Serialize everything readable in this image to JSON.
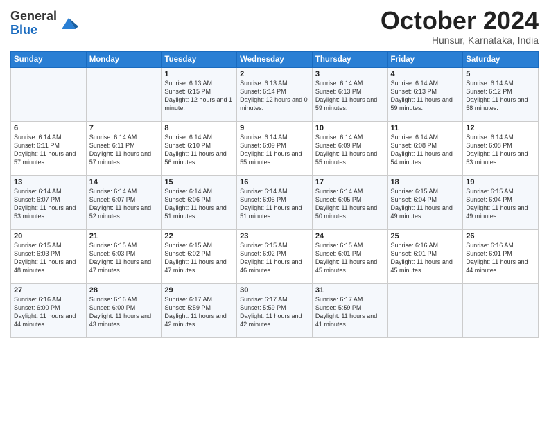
{
  "logo": {
    "general": "General",
    "blue": "Blue"
  },
  "header": {
    "month": "October 2024",
    "location": "Hunsur, Karnataka, India"
  },
  "days_of_week": [
    "Sunday",
    "Monday",
    "Tuesday",
    "Wednesday",
    "Thursday",
    "Friday",
    "Saturday"
  ],
  "weeks": [
    [
      {
        "day": "",
        "info": ""
      },
      {
        "day": "",
        "info": ""
      },
      {
        "day": "1",
        "info": "Sunrise: 6:13 AM\nSunset: 6:15 PM\nDaylight: 12 hours and 1 minute."
      },
      {
        "day": "2",
        "info": "Sunrise: 6:13 AM\nSunset: 6:14 PM\nDaylight: 12 hours and 0 minutes."
      },
      {
        "day": "3",
        "info": "Sunrise: 6:14 AM\nSunset: 6:13 PM\nDaylight: 11 hours and 59 minutes."
      },
      {
        "day": "4",
        "info": "Sunrise: 6:14 AM\nSunset: 6:13 PM\nDaylight: 11 hours and 59 minutes."
      },
      {
        "day": "5",
        "info": "Sunrise: 6:14 AM\nSunset: 6:12 PM\nDaylight: 11 hours and 58 minutes."
      }
    ],
    [
      {
        "day": "6",
        "info": "Sunrise: 6:14 AM\nSunset: 6:11 PM\nDaylight: 11 hours and 57 minutes."
      },
      {
        "day": "7",
        "info": "Sunrise: 6:14 AM\nSunset: 6:11 PM\nDaylight: 11 hours and 57 minutes."
      },
      {
        "day": "8",
        "info": "Sunrise: 6:14 AM\nSunset: 6:10 PM\nDaylight: 11 hours and 56 minutes."
      },
      {
        "day": "9",
        "info": "Sunrise: 6:14 AM\nSunset: 6:09 PM\nDaylight: 11 hours and 55 minutes."
      },
      {
        "day": "10",
        "info": "Sunrise: 6:14 AM\nSunset: 6:09 PM\nDaylight: 11 hours and 55 minutes."
      },
      {
        "day": "11",
        "info": "Sunrise: 6:14 AM\nSunset: 6:08 PM\nDaylight: 11 hours and 54 minutes."
      },
      {
        "day": "12",
        "info": "Sunrise: 6:14 AM\nSunset: 6:08 PM\nDaylight: 11 hours and 53 minutes."
      }
    ],
    [
      {
        "day": "13",
        "info": "Sunrise: 6:14 AM\nSunset: 6:07 PM\nDaylight: 11 hours and 53 minutes."
      },
      {
        "day": "14",
        "info": "Sunrise: 6:14 AM\nSunset: 6:07 PM\nDaylight: 11 hours and 52 minutes."
      },
      {
        "day": "15",
        "info": "Sunrise: 6:14 AM\nSunset: 6:06 PM\nDaylight: 11 hours and 51 minutes."
      },
      {
        "day": "16",
        "info": "Sunrise: 6:14 AM\nSunset: 6:05 PM\nDaylight: 11 hours and 51 minutes."
      },
      {
        "day": "17",
        "info": "Sunrise: 6:14 AM\nSunset: 6:05 PM\nDaylight: 11 hours and 50 minutes."
      },
      {
        "day": "18",
        "info": "Sunrise: 6:15 AM\nSunset: 6:04 PM\nDaylight: 11 hours and 49 minutes."
      },
      {
        "day": "19",
        "info": "Sunrise: 6:15 AM\nSunset: 6:04 PM\nDaylight: 11 hours and 49 minutes."
      }
    ],
    [
      {
        "day": "20",
        "info": "Sunrise: 6:15 AM\nSunset: 6:03 PM\nDaylight: 11 hours and 48 minutes."
      },
      {
        "day": "21",
        "info": "Sunrise: 6:15 AM\nSunset: 6:03 PM\nDaylight: 11 hours and 47 minutes."
      },
      {
        "day": "22",
        "info": "Sunrise: 6:15 AM\nSunset: 6:02 PM\nDaylight: 11 hours and 47 minutes."
      },
      {
        "day": "23",
        "info": "Sunrise: 6:15 AM\nSunset: 6:02 PM\nDaylight: 11 hours and 46 minutes."
      },
      {
        "day": "24",
        "info": "Sunrise: 6:15 AM\nSunset: 6:01 PM\nDaylight: 11 hours and 45 minutes."
      },
      {
        "day": "25",
        "info": "Sunrise: 6:16 AM\nSunset: 6:01 PM\nDaylight: 11 hours and 45 minutes."
      },
      {
        "day": "26",
        "info": "Sunrise: 6:16 AM\nSunset: 6:01 PM\nDaylight: 11 hours and 44 minutes."
      }
    ],
    [
      {
        "day": "27",
        "info": "Sunrise: 6:16 AM\nSunset: 6:00 PM\nDaylight: 11 hours and 44 minutes."
      },
      {
        "day": "28",
        "info": "Sunrise: 6:16 AM\nSunset: 6:00 PM\nDaylight: 11 hours and 43 minutes."
      },
      {
        "day": "29",
        "info": "Sunrise: 6:17 AM\nSunset: 5:59 PM\nDaylight: 11 hours and 42 minutes."
      },
      {
        "day": "30",
        "info": "Sunrise: 6:17 AM\nSunset: 5:59 PM\nDaylight: 11 hours and 42 minutes."
      },
      {
        "day": "31",
        "info": "Sunrise: 6:17 AM\nSunset: 5:59 PM\nDaylight: 11 hours and 41 minutes."
      },
      {
        "day": "",
        "info": ""
      },
      {
        "day": "",
        "info": ""
      }
    ]
  ]
}
